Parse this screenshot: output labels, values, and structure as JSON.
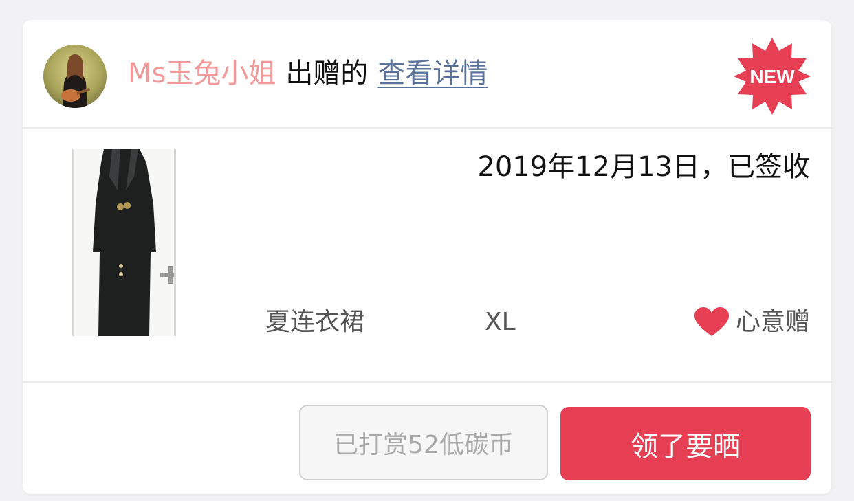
{
  "header": {
    "username": "Ms玉兔小姐",
    "action_text": "出赠的",
    "detail_link": "查看详情",
    "badge": "NEW"
  },
  "item": {
    "status": "2019年12月13日，已签收",
    "category": "夏连衣裙",
    "size": "XL",
    "gift_type": "心意赠",
    "gift_icon": "heart-icon"
  },
  "actions": {
    "tip_label": "已打赏52低碳币",
    "claim_label": "领了要晒"
  },
  "colors": {
    "accent": "#e63e52",
    "username": "#f29a9a",
    "link": "#5a7199"
  }
}
